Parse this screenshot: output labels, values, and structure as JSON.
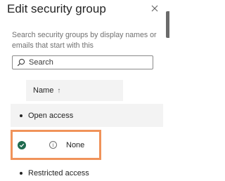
{
  "panel": {
    "title": "Edit security group",
    "close_icon": "close-icon"
  },
  "search": {
    "description": "Search security groups by display names or emails that start with this",
    "placeholder": "Search",
    "icon": "search-icon"
  },
  "table": {
    "column_header": "Name",
    "sort_indicator": "↑"
  },
  "groups": [
    {
      "label": "Open access",
      "options": [
        {
          "label": "None",
          "selected": true,
          "icons": [
            "check-circle-icon",
            "info-icon"
          ]
        }
      ]
    },
    {
      "label": "Restricted access"
    }
  ],
  "colors": {
    "selected_check": "#1f6b4f",
    "highlight_border": "#f0935a",
    "header_bg": "#f3f3f3"
  }
}
